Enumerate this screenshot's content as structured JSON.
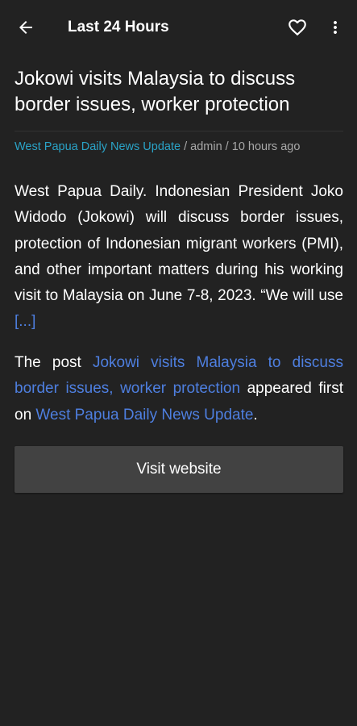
{
  "header": {
    "title": "Last 24 Hours",
    "back_icon": "arrow-left-icon",
    "favorite_icon": "heart-outline-icon",
    "more_icon": "more-vertical-icon"
  },
  "article": {
    "title": "Jokowi visits Malaysia to discuss border issues, worker protection",
    "source": "West Papua Daily News Update",
    "separator_1": " / ",
    "author": "admin",
    "separator_2": " / ",
    "time_ago": "10 hours ago",
    "excerpt": "West Papua Daily. Indonesian President Joko Widodo (Jokowi) will discuss border issues, protection of Indonesian migrant workers (PMI), and other important matters during his working visit to Malaysia on June 7-8, 2023. “We will use ",
    "read_more": "[...]",
    "footer_prefix": "The post ",
    "footer_post_link": "Jokowi visits Malaysia to discuss border issues, worker protection",
    "footer_middle": " appeared first on ",
    "footer_site_link": "West Papua Daily News Update",
    "footer_suffix": "."
  },
  "actions": {
    "visit_label": "Visit website"
  },
  "colors": {
    "background": "#222222",
    "source_link": "#2aa3c7",
    "body_link": "#4e7fe0",
    "button": "#424242"
  }
}
